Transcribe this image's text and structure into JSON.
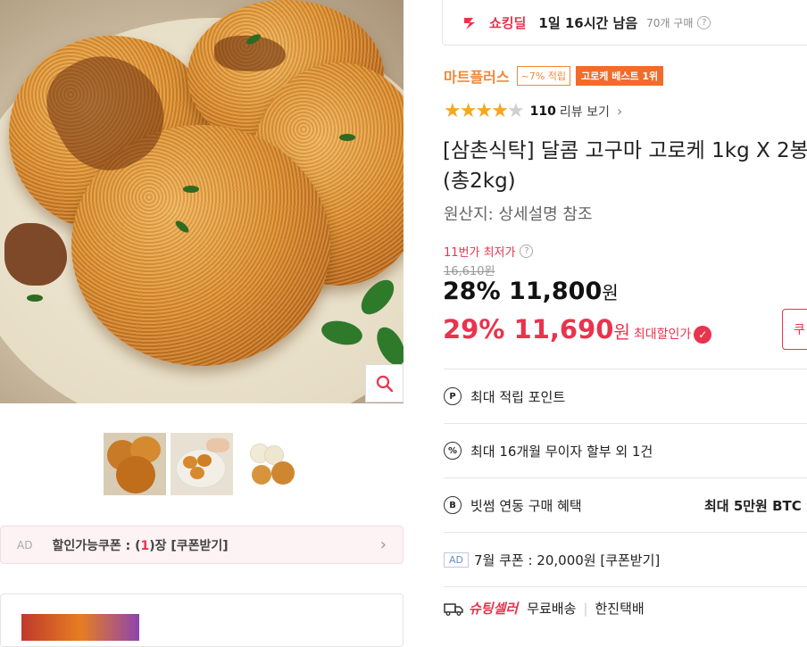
{
  "deal": {
    "label": "쇼킹딜",
    "time_left": "1일 16시간 남음",
    "purchases": "70개 구매",
    "help": "?"
  },
  "brand": {
    "name": "마트플러스",
    "points_badge": "~7% 적립",
    "best_badge": "고로케 베스트 1위"
  },
  "rating": {
    "stars_filled": 4,
    "stars_total": 5,
    "review_count": "110",
    "review_label": "리뷰 보기",
    "chevron": "›"
  },
  "product": {
    "title": "[삼촌식탁] 달콤 고구마 고로케 1kg X 2봉 (총2kg)",
    "origin": "원산지:  상세설명 참조"
  },
  "price": {
    "lowest_label": "11번가 최저가",
    "original": "16,610원",
    "discount_rate": "28%",
    "sale_price": "11,800",
    "won": "원",
    "max_rate": "29%",
    "max_price": "11,690",
    "max_label": "최대할인가",
    "side_button": "쿠"
  },
  "benefits": [
    {
      "icon": "P",
      "label": "최대 적립 포인트",
      "value": ""
    },
    {
      "icon": "%",
      "label": "최대 16개월 무이자 할부 외 1건",
      "value": ""
    },
    {
      "icon": "B",
      "label": "빗썸 연동 구매 혜택",
      "value": "최대 5만원 BTC"
    }
  ],
  "coupon_row": {
    "ad": "AD",
    "text": "7월 쿠폰 : 20,000원 [쿠폰받기]"
  },
  "shipping": {
    "seller": "슈팅셀러",
    "free": "무료배송",
    "courier": "한진택배"
  },
  "coupon_bar": {
    "ad": "AD",
    "prefix": "할인가능쿠폰 : (",
    "count": "1",
    "suffix": ")장 [쿠폰받기]",
    "chevron": "›"
  },
  "icons": {
    "zoom": "search-icon",
    "truck": "truck-icon",
    "deal": "shocking-deal-icon"
  },
  "colors": {
    "accent_red": "#e8344e",
    "brand_orange": "#f0883a",
    "star": "#f5a623"
  }
}
